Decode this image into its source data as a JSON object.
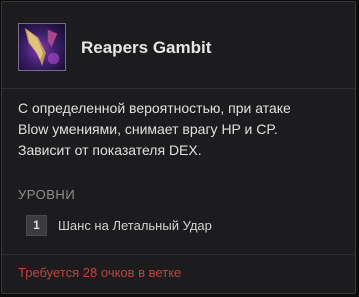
{
  "skill": {
    "icon": "reaper-blade-icon",
    "title": "Reapers Gambit",
    "description_lines": [
      "С определенной вероятностью, при атаке",
      "Blow умениями, снимает врагу HP и CP.",
      "Зависит от показателя DEX."
    ]
  },
  "levels": {
    "heading": "УРОВНИ",
    "items": [
      {
        "number": "1",
        "text": "Шанс на Летальный Удар"
      }
    ]
  },
  "requirement": "Требуется 28 очков в ветке",
  "colors": {
    "panel_bg": "#1c1c1e",
    "requirement_red": "#c0433c",
    "title_text": "#e6e6e6"
  }
}
